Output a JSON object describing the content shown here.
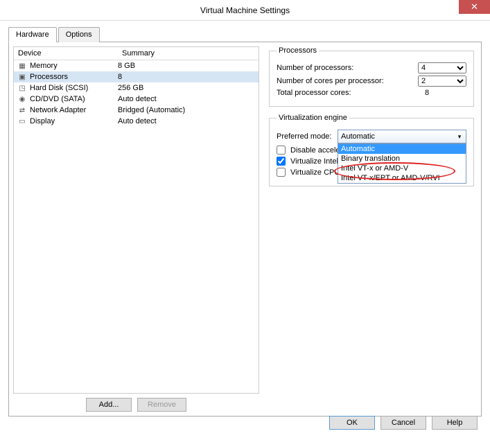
{
  "title": "Virtual Machine Settings",
  "tabs": {
    "hardware": "Hardware",
    "options": "Options"
  },
  "device_header": {
    "device": "Device",
    "summary": "Summary"
  },
  "devices": [
    {
      "icon": "memory-icon",
      "name": "Memory",
      "summary": "8 GB"
    },
    {
      "icon": "cpu-icon",
      "name": "Processors",
      "summary": "8",
      "selected": true
    },
    {
      "icon": "disk-icon",
      "name": "Hard Disk (SCSI)",
      "summary": "256 GB"
    },
    {
      "icon": "cd-icon",
      "name": "CD/DVD (SATA)",
      "summary": "Auto detect"
    },
    {
      "icon": "net-icon",
      "name": "Network Adapter",
      "summary": "Bridged (Automatic)"
    },
    {
      "icon": "display-icon",
      "name": "Display",
      "summary": "Auto detect"
    }
  ],
  "buttons": {
    "add": "Add...",
    "remove": "Remove",
    "ok": "OK",
    "cancel": "Cancel",
    "help": "Help"
  },
  "processors": {
    "legend": "Processors",
    "num_label": "Number of processors:",
    "num_value": "4",
    "cores_label": "Number of cores per processor:",
    "cores_value": "2",
    "total_label": "Total processor cores:",
    "total_value": "8"
  },
  "virt_engine": {
    "legend": "Virtualization engine",
    "pref_label": "Preferred mode:",
    "selected": "Automatic",
    "options": [
      "Automatic",
      "Binary translation",
      "Intel VT-x or AMD-V",
      "Intel VT-x/EPT or AMD-V/RVI"
    ],
    "chk_disable": "Disable accele",
    "chk_virt_intel": "Virtualize Intel",
    "chk_virt_cpu": "Virtualize CPU"
  }
}
